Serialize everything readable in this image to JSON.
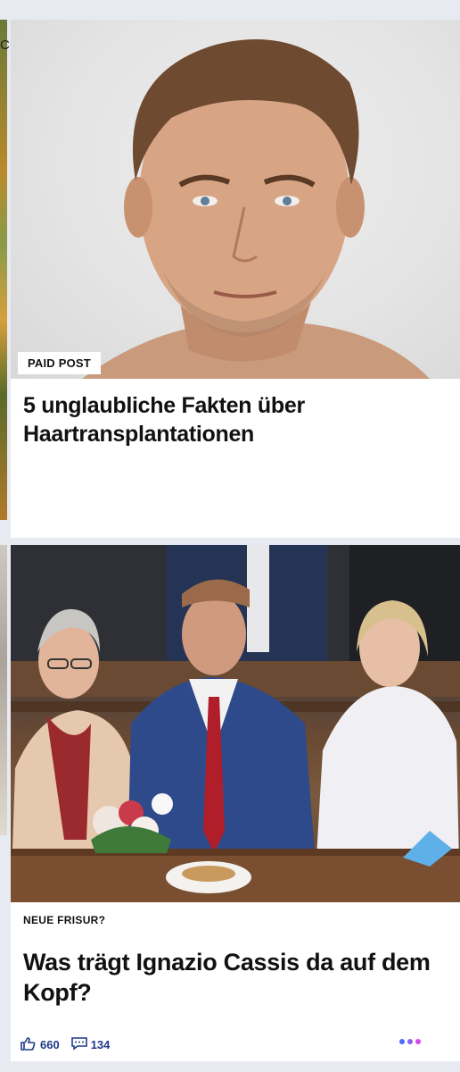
{
  "strip": {
    "letter": "C"
  },
  "card1": {
    "badge": "PAID POST",
    "title": "5 unglaubliche Fakten über Haartransplantationen"
  },
  "card2": {
    "kicker": "NEUE FRISUR?",
    "title": "Was trägt Ignazio Cassis da auf dem Kopf?",
    "likes": "660",
    "comments": "134",
    "dot_colors": [
      "#4a6cf7",
      "#8b5cf6",
      "#d946ef"
    ]
  }
}
